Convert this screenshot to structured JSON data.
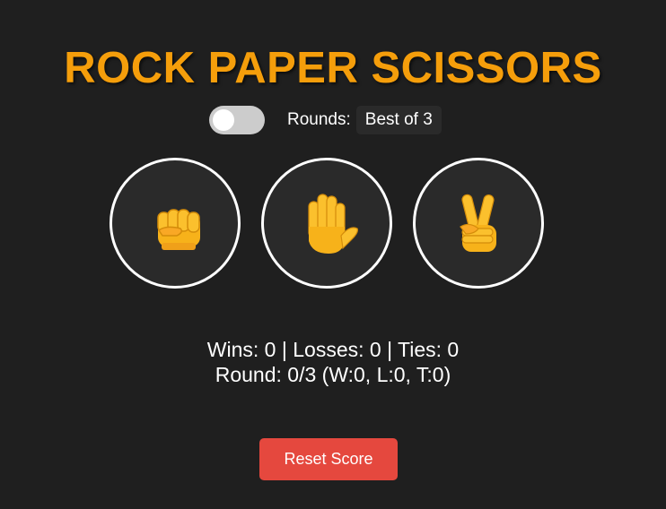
{
  "title": "ROCK PAPER SCISSORS",
  "controls": {
    "toggle_on": false,
    "rounds_label": "Rounds:",
    "rounds_value": "Best of 3"
  },
  "choices": [
    {
      "name": "rock",
      "icon": "fist-emoji-icon"
    },
    {
      "name": "paper",
      "icon": "raised-hand-emoji-icon"
    },
    {
      "name": "scissors",
      "icon": "victory-hand-emoji-icon"
    }
  ],
  "score": {
    "totals": "Wins: 0 | Losses: 0 | Ties: 0",
    "round": "Round: 0/3 (W:0, L:0, T:0)"
  },
  "reset_label": "Reset Score",
  "colors": {
    "title": "#f59e0b",
    "reset_button": "#e5483e",
    "background": "#1f1f1f"
  }
}
